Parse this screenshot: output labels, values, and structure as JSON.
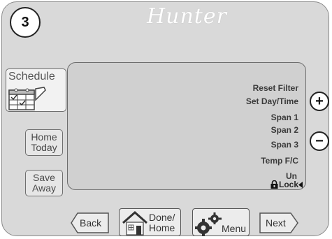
{
  "step_number": "3",
  "brand": "Hunter",
  "sidebar": {
    "schedule_label": "Schedule",
    "home_today": [
      "Home",
      "Today"
    ],
    "save_away": [
      "Save",
      "Away"
    ]
  },
  "lcd_menu": {
    "items": [
      "Reset Filter",
      "Set Day/Time",
      "Span 1",
      "Span 2",
      "Span 3",
      "Temp F/C"
    ],
    "unlock_top": "Un",
    "unlock_bottom": "Lock"
  },
  "adjust": {
    "plus": "+",
    "minus": "−"
  },
  "bottom_nav": {
    "back": "Back",
    "done_home": [
      "Done/",
      "Home"
    ],
    "menu": "Menu",
    "next": "Next"
  }
}
